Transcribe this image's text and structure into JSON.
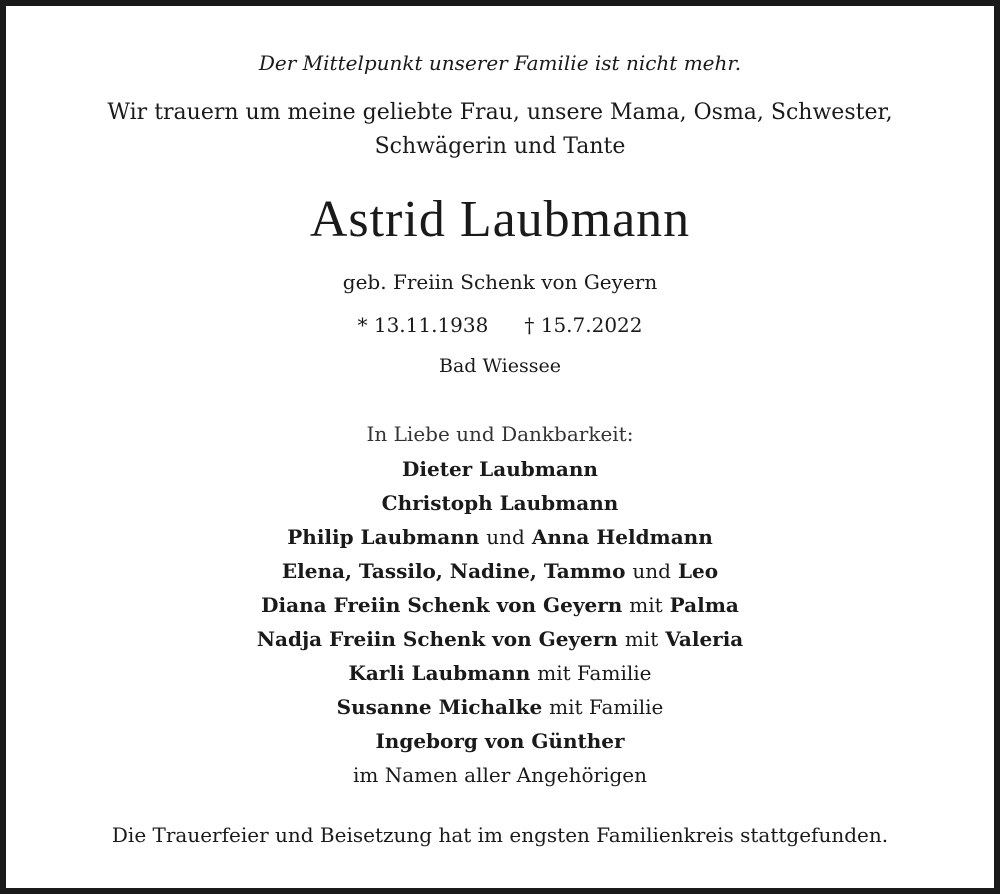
{
  "notice": {
    "intro": "Der Mittelpunkt unserer Familie ist nicht mehr.",
    "mourning_line1": "Wir trauern um meine geliebte Frau, unsere Mama, Osma, Schwester,",
    "mourning_line2": "Schwägerin und Tante",
    "name": "Astrid Laubmann",
    "birth_name": "geb. Freiin Schenk von Geyern",
    "born": "* 13.11.1938",
    "died": "† 15.7.2022",
    "place": "Bad Wiessee",
    "thanks": "In Liebe und Dankbarkeit:",
    "family": {
      "dieter": "Dieter Laubmann",
      "christoph": "Christoph Laubmann",
      "philip": "Philip Laubmann",
      "und1": "und",
      "anna": "Anna Heldmann",
      "grandchildren": "Elena, Tassilo, Nadine, Tammo",
      "und2": "und",
      "leo": "Leo",
      "diana": "Diana Freiin Schenk von Geyern",
      "mit1": "mit",
      "palma": "Palma",
      "nadja": "Nadja Freiin Schenk von Geyern",
      "mit2": "mit",
      "valeria": "Valeria",
      "karli": "Karli Laubmann",
      "mit_familie1": "mit Familie",
      "susanne": "Susanne Michalke",
      "mit_familie2": "mit Familie",
      "ingeborg": "Ingeborg von Günther",
      "on_behalf": "im Namen aller Angehörigen"
    },
    "closing": "Die Trauerfeier und Beisetzung hat im engsten Familienkreis stattgefunden."
  }
}
